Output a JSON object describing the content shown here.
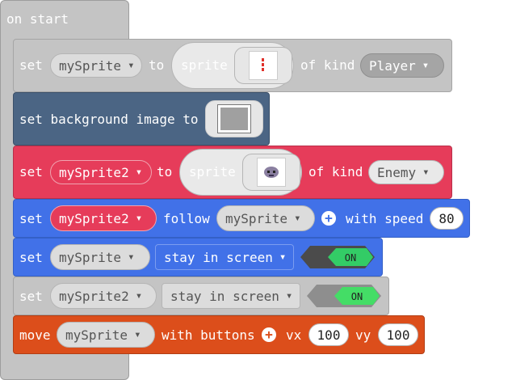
{
  "hat": {
    "label": "on start"
  },
  "blocks": [
    {
      "parts": [
        "set",
        "mySprite",
        "to",
        "sprite",
        "of kind",
        "Player"
      ]
    },
    {
      "parts": [
        "set background image to"
      ]
    },
    {
      "parts": [
        "set",
        "mySprite2",
        "to",
        "sprite",
        "of kind",
        "Enemy"
      ]
    },
    {
      "parts": [
        "set",
        "mySprite2",
        "follow",
        "mySprite",
        "with speed",
        "80"
      ]
    },
    {
      "parts": [
        "set",
        "mySprite",
        "stay in screen",
        "ON"
      ]
    },
    {
      "parts": [
        "set",
        "mySprite2",
        "stay in screen",
        "ON"
      ]
    },
    {
      "parts": [
        "move",
        "mySprite",
        "with buttons",
        "vx",
        "100",
        "vy",
        "100"
      ]
    }
  ],
  "colors": {
    "grey": "#c4c4c4",
    "slate": "#4b6584",
    "red": "#e63c5a",
    "blue": "#4171e8",
    "orange": "#dc4e1b",
    "toggle_on": "#33cc66"
  },
  "icons": [
    "add-icon",
    "sprite-image-icon",
    "background-image-icon",
    "enemy-sprite-icon"
  ]
}
